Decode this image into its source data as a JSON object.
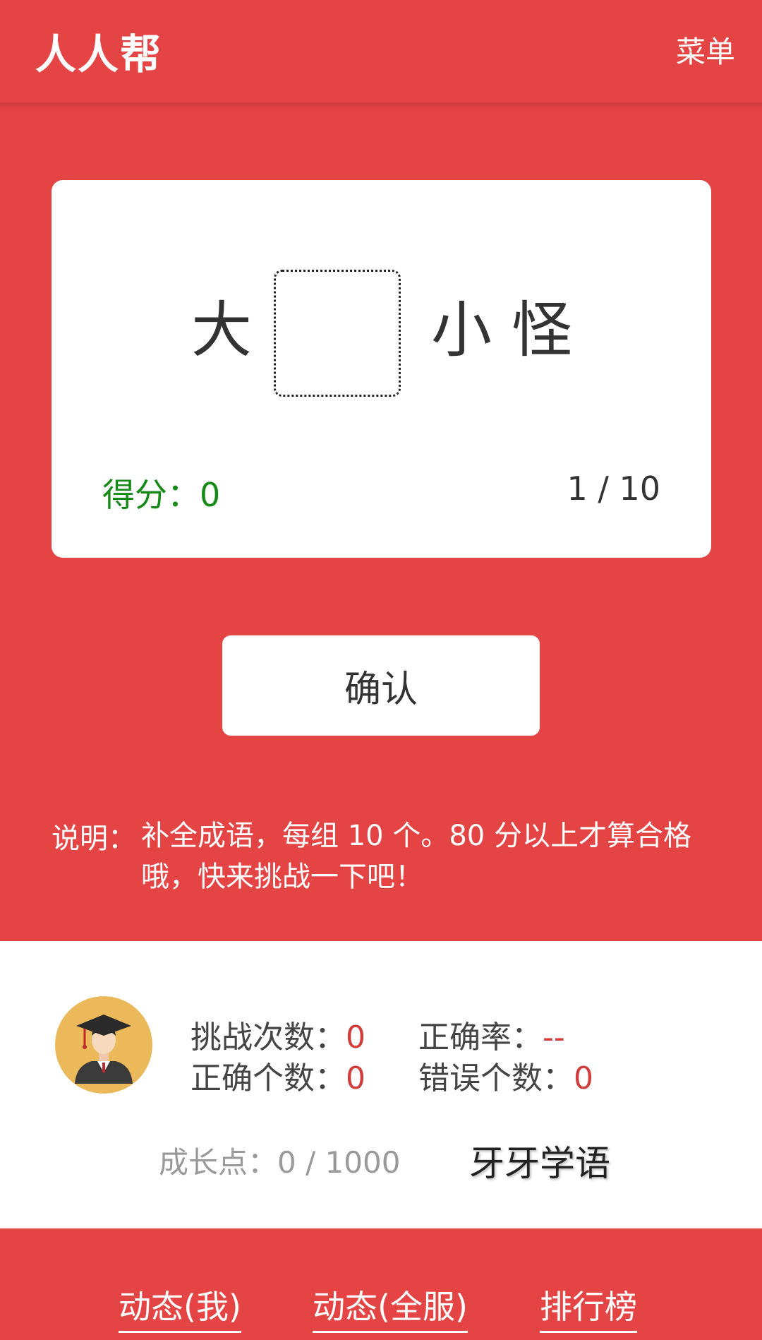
{
  "header": {
    "title": "人人帮",
    "menu_label": "菜单"
  },
  "puzzle": {
    "chars": [
      "大",
      "小",
      "怪"
    ],
    "blank_value": "",
    "score_label": "得分：",
    "score_value": "0",
    "progress": "1 / 10"
  },
  "confirm_label": "确认",
  "instructions": {
    "label": "说明：",
    "text": "补全成语，每组 10 个。80 分以上才算合格哦，快来挑战一下吧！"
  },
  "stats": {
    "attempts_label": "挑战次数：",
    "attempts_value": "0",
    "accuracy_label": "正确率：",
    "accuracy_value": "--",
    "correct_label": "正确个数：",
    "correct_value": "0",
    "wrong_label": "错误个数：",
    "wrong_value": "0",
    "growth_label": "成长点：",
    "growth_value": "0 / 1000",
    "level_name": "牙牙学语"
  },
  "avatar_icon": "graduate-avatar-icon",
  "nav": {
    "my_feed": "动态(我)",
    "all_feed": "动态(全服)",
    "leaderboard": "排行榜"
  },
  "colors": {
    "primary": "#e54444",
    "score_green": "#168a16",
    "value_red": "#d13c3c",
    "avatar_bg": "#ebb95a"
  }
}
